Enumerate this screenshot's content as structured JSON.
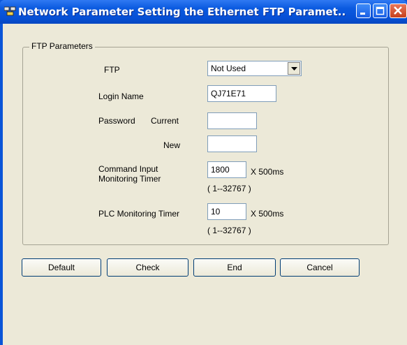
{
  "window": {
    "title": "Network Parameter  Setting the Ethernet FTP Paramet..."
  },
  "group": {
    "title": "FTP Parameters"
  },
  "ftp": {
    "label": "FTP",
    "selected": "Not Used"
  },
  "login": {
    "label": "Login Name",
    "value": "QJ71E71"
  },
  "password": {
    "label": "Password",
    "current_label": "Current",
    "current_value": "",
    "new_label": "New",
    "new_value": ""
  },
  "command_timer": {
    "label_line1": "Command Input",
    "label_line2": "Monitoring Timer",
    "value": "1800",
    "unit": "X 500ms",
    "range": "( 1--32767 )"
  },
  "plc_timer": {
    "label": "PLC Monitoring Timer",
    "value": "10",
    "unit": "X 500ms",
    "range": "( 1--32767 )"
  },
  "buttons": {
    "default": "Default",
    "check": "Check",
    "end": "End",
    "cancel": "Cancel"
  }
}
